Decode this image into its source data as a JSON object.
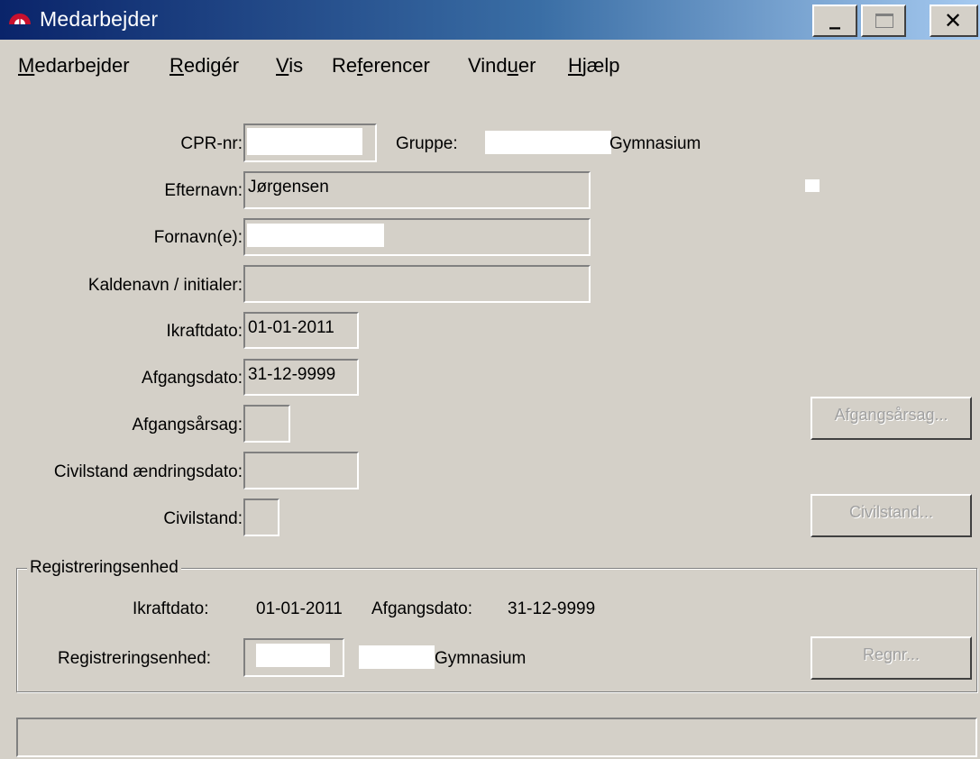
{
  "window": {
    "title": "Medarbejder",
    "minimize_glyph": "_",
    "close_glyph": "✕"
  },
  "menu": [
    {
      "label": "Medarbejder",
      "mnemonic": "M"
    },
    {
      "label": "Redigér",
      "mnemonic": "R"
    },
    {
      "label": "Vis",
      "mnemonic": "V"
    },
    {
      "label": "Referencer",
      "mnemonic": "f"
    },
    {
      "label": "Vinduer",
      "mnemonic": "u"
    },
    {
      "label": "Hjælp",
      "mnemonic": "H"
    }
  ],
  "form": {
    "cpr_label": "CPR-nr:",
    "gruppe_label": "Gruppe:",
    "gruppe_value": "Gymnasium",
    "efternavn_label": "Efternavn:",
    "efternavn_value": "Jørgensen",
    "fornavn_label": "Fornavn(e):",
    "kaldenavn_label": "Kaldenavn / initialer:",
    "kaldenavn_value": "",
    "ikraftdato_label": "Ikraftdato:",
    "ikraftdato_value": "01-01-2011",
    "afgangsdato_label": "Afgangsdato:",
    "afgangsdato_value": "31-12-9999",
    "afgangsaarsag_label": "Afgangsårsag:",
    "afgangsaarsag_value": "",
    "civilstand_dato_label": "Civilstand ændringsdato:",
    "civilstand_dato_value": "",
    "civilstand_label": "Civilstand:",
    "civilstand_value": "",
    "afgangsaarsag_button": "Afgangsårsag...",
    "civilstand_button": "Civilstand..."
  },
  "registrering": {
    "group_title": "Registreringsenhed",
    "ikraftdato_label": "Ikraftdato:",
    "ikraftdato_value": "01-01-2011",
    "afgangsdato_label": "Afgangsdato:",
    "afgangsdato_value": "31-12-9999",
    "enhed_label": "Registreringsenhed:",
    "enhed_name": "Gymnasium",
    "regnr_button": "Regnr..."
  },
  "status": {
    "text": ""
  }
}
